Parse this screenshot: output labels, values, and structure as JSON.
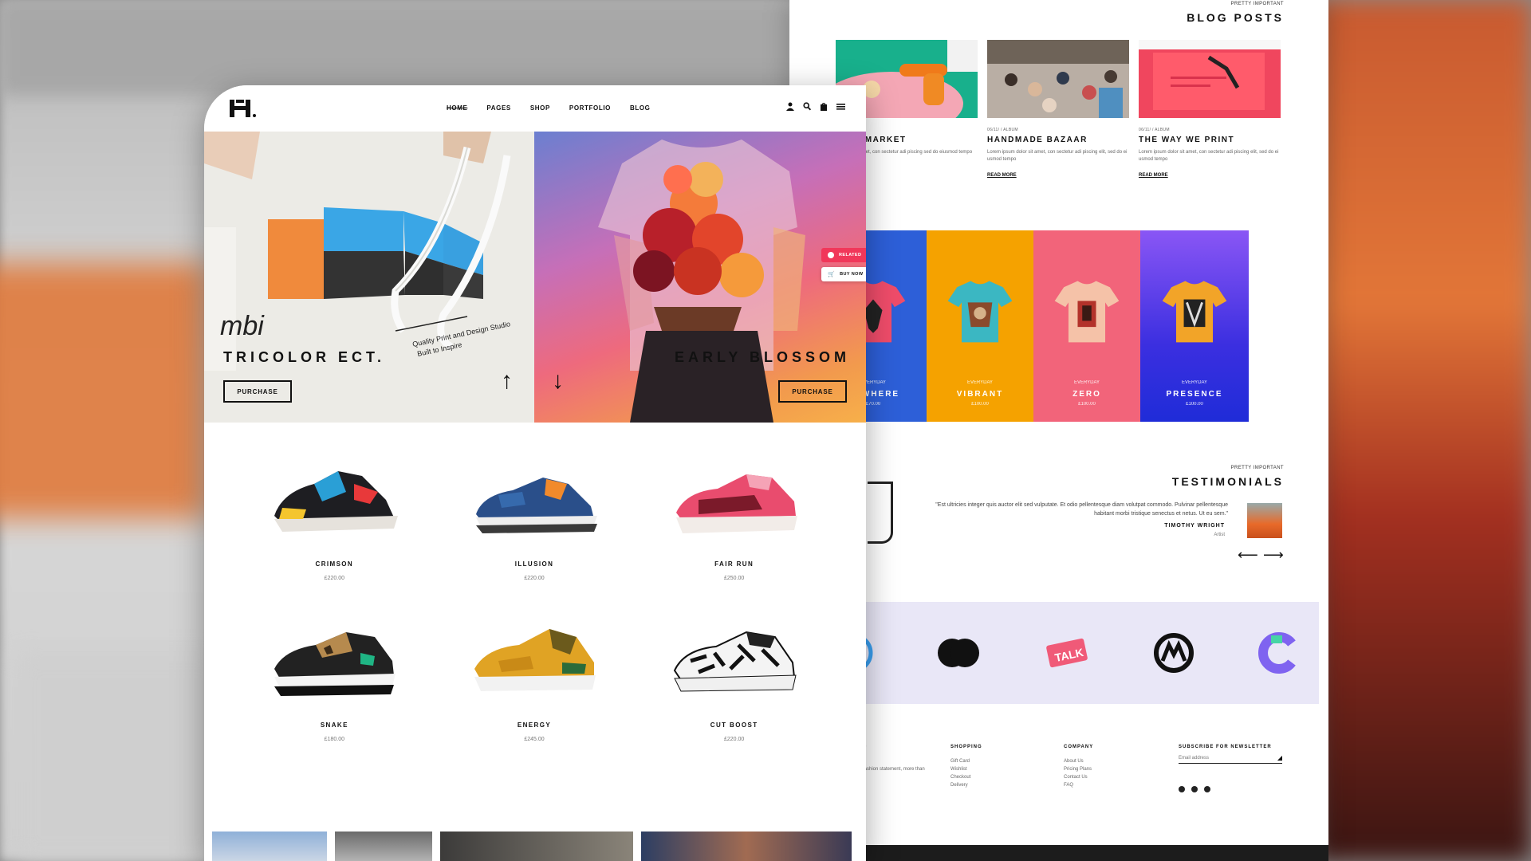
{
  "nav": {
    "menu": [
      "HOME",
      "PAGES",
      "SHOP",
      "PORTFOLIO",
      "BLOG"
    ]
  },
  "hero": {
    "left_title": "TRICOLOR ECT.",
    "left_button": "PURCHASE",
    "right_title": "EARLY BLOSSOM",
    "right_button": "PURCHASE",
    "left_bag_text": "Quality Print and Design Studio",
    "left_bag_text2": "Built to Inspire"
  },
  "float": {
    "related": "RELATED",
    "buy": "BUY NOW"
  },
  "products": [
    {
      "name": "CRIMSON",
      "price": "£220.00"
    },
    {
      "name": "ILLUSION",
      "price": "£220.00"
    },
    {
      "name": "FAIR RUN",
      "price": "£250.00"
    },
    {
      "name": "SNAKE",
      "price": "£180.00"
    },
    {
      "name": "ENERGY",
      "price": "£245.00"
    },
    {
      "name": "CUT BOOST",
      "price": "£220.00"
    }
  ],
  "blog": {
    "pretty": "PRETTY IMPORTANT",
    "title": "BLOG POSTS",
    "posts": [
      {
        "meta": "ALBUM",
        "title": "ATED MARKET",
        "text": "m dolor sit amet, con sectetur adi piscing\nsed do eiusmod tempo",
        "more": ""
      },
      {
        "meta": "06/11/   / ALBUM",
        "title": "HANDMADE BAZAAR",
        "text": "Lorem ipsum dolor sit amet, con sectetur adi piscing\nelit, sed do ei usmod tempo",
        "more": "READ MORE"
      },
      {
        "meta": "06/11/   / ALBUM",
        "title": "THE WAY WE PRINT",
        "text": "Lorem ipsum dolor sit amet, con sectetur adi piscing\nelit, sed do ei usmod tempo",
        "more": "READ MORE"
      }
    ]
  },
  "tees": [
    {
      "sub": "",
      "name": "",
      "price": "",
      "color": "#e8503a"
    },
    {
      "sub": "EVERYDAY",
      "name": "NOWHERE",
      "price": "£70.00",
      "color": "#2d5fd8"
    },
    {
      "sub": "EVERYDAY",
      "name": "VIBRANT",
      "price": "£100.00",
      "color": "#f5a200"
    },
    {
      "sub": "EVERYDAY",
      "name": "ZERO",
      "price": "£100.00",
      "color": "#f2647a"
    },
    {
      "sub": "EVERYDAY",
      "name": "PRESENCE",
      "price": "£100.00",
      "color": "#6a4cf2"
    }
  ],
  "testimonials": {
    "pretty": "PRETTY IMPORTANT",
    "title": "TESTIMONIALS",
    "quote": "\"Est ultricies integer quis auctor elit sed vulputate. Et odio pellentesque diam volutpat commodo. Pulvinar pellentesque habitant morbi tristique senectus et netus. Ut eu sem.\"",
    "name": "TIMOTHY WRIGHT",
    "role": "Artist",
    "prev": "⟵",
    "next": "⟶"
  },
  "footer": {
    "col1_head": "D",
    "col1_text": "fashion statement, more than",
    "shopping_head": "SHOPPING",
    "shopping": [
      "Gift Card",
      "Wishlist",
      "Checkout",
      "Delivery"
    ],
    "company_head": "COMPANY",
    "company": [
      "About Us",
      "Pricing Plans",
      "Contact Us",
      "FAQ"
    ],
    "newsletter_head": "SUBSCRIBE FOR NEWSLETTER",
    "newsletter_placeholder": "Email address"
  }
}
